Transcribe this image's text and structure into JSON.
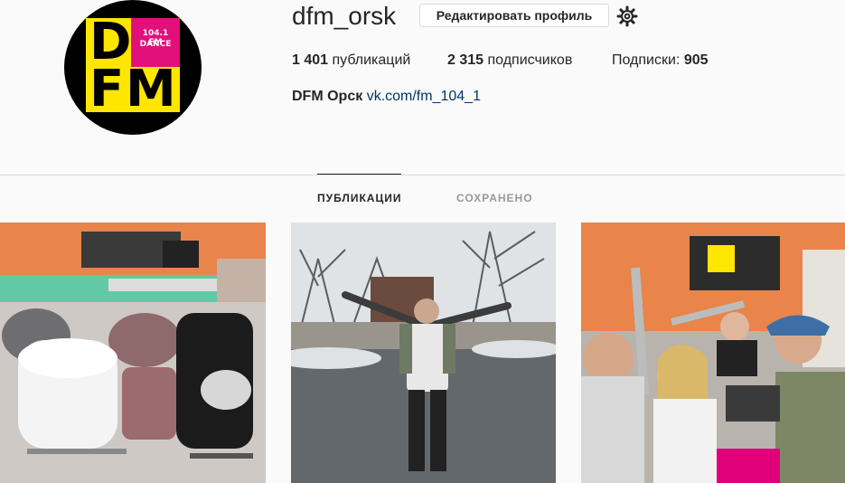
{
  "profile": {
    "username": "dfm_orsk",
    "edit_button": "Редактировать профиль",
    "avatar_logo": {
      "letters": [
        "D",
        "F",
        "M"
      ],
      "badge_line1": "104.1 FM",
      "badge_line2": "DANCE",
      "colors": {
        "yellow": "#ffe600",
        "pink": "#e2107a",
        "black": "#000000"
      }
    },
    "stats": {
      "posts_count": "1 401",
      "posts_label": " публикаций",
      "followers_count": "2 315",
      "followers_label": " подписчиков",
      "following_label": "Подписки: ",
      "following_count": "905"
    },
    "bio": {
      "name": "DFM Орск",
      "link": "vk.com/fm_104_1"
    }
  },
  "tabs": [
    {
      "label": "ПУБЛИКАЦИИ",
      "active": true
    },
    {
      "label": "СОХРАНЕНО",
      "active": false
    }
  ],
  "posts": [
    {
      "subject": "radio studio with chairs"
    },
    {
      "subject": "man with raised arms outdoors"
    },
    {
      "subject": "group of people in radio studio"
    }
  ],
  "icons": {
    "settings": "gear-icon"
  }
}
